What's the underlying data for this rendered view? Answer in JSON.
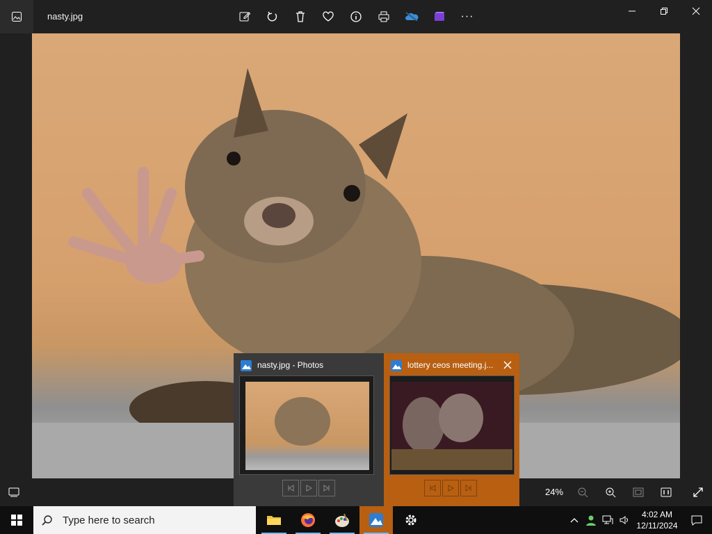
{
  "window": {
    "file_name": "nasty.jpg"
  },
  "toolbar": {
    "icons": [
      "edit-icon",
      "rotate-icon",
      "delete-icon",
      "favorite-icon",
      "info-icon",
      "print-icon",
      "onedrive-icon",
      "video-editor-icon",
      "more-icon"
    ],
    "more_label": "···"
  },
  "bottombar": {
    "zoom": "24%"
  },
  "thumbnails": [
    {
      "title": "nasty.jpg - Photos"
    },
    {
      "title": "lottery ceos meeting.j..."
    }
  ],
  "taskbar": {
    "search_placeholder": "Type here to search",
    "apps": [
      "file-explorer",
      "firefox",
      "paint",
      "photos",
      "settings"
    ],
    "clock_time": "4:02 AM",
    "clock_date": "12/11/2024"
  },
  "colors": {
    "accent_orange": "#b85f12",
    "chrome": "#202020"
  }
}
